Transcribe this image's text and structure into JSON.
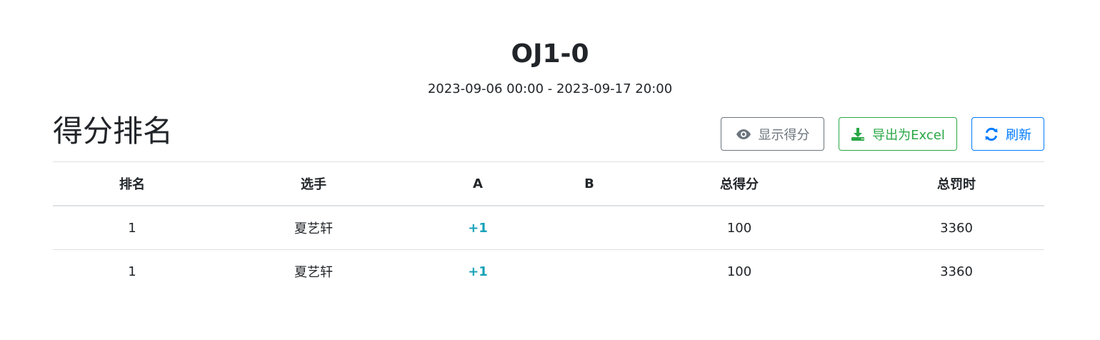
{
  "contest": {
    "title": "OJ1-0",
    "time_range": "2023-09-06 00:00 - 2023-09-17 20:00"
  },
  "ranking": {
    "heading": "得分排名",
    "buttons": {
      "show_score": "显示得分",
      "export_excel": "导出为Excel",
      "refresh": "刷新"
    },
    "columns": [
      "排名",
      "选手",
      "A",
      "B",
      "总得分",
      "总罚时"
    ],
    "rows": [
      {
        "rank": "1",
        "player": "夏艺轩",
        "A": "+1",
        "B": "",
        "total_score": "100",
        "total_penalty": "3360"
      },
      {
        "rank": "1",
        "player": "夏艺轩",
        "A": "+1",
        "B": "",
        "total_score": "100",
        "total_penalty": "3360"
      }
    ]
  },
  "colors": {
    "secondary": "#6c757d",
    "success": "#28a745",
    "primary": "#007bff",
    "accepted": "#17a2b8"
  },
  "icons": {
    "show_score": "eye-icon",
    "export_excel": "download-icon",
    "refresh": "refresh-icon"
  }
}
